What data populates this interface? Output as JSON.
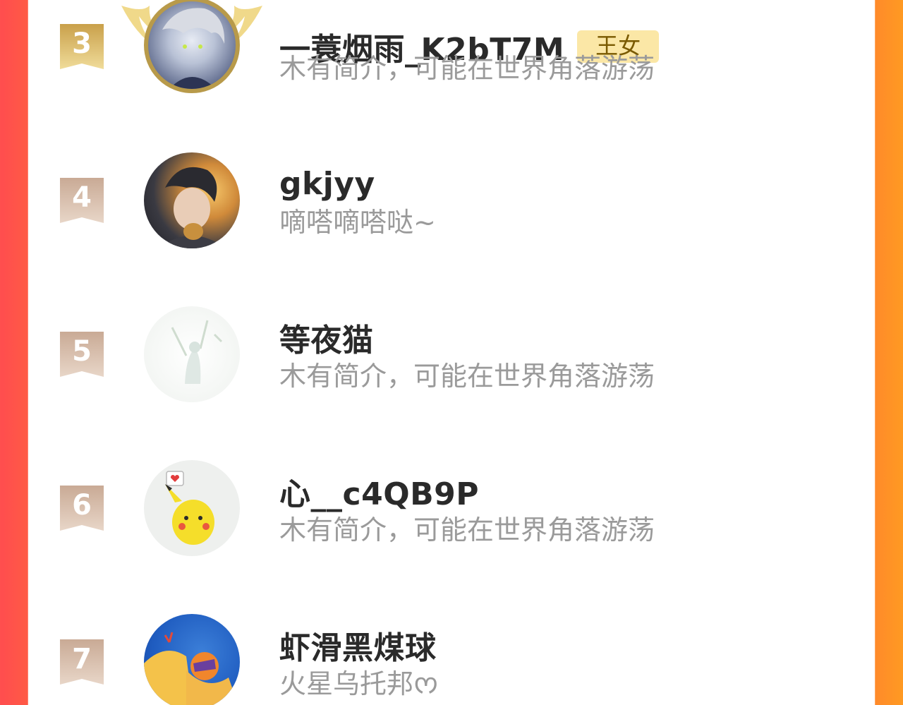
{
  "ranking": {
    "items": [
      {
        "rank": "3",
        "name": "一蓑烟雨_K2bT7M",
        "badge": "王女",
        "bio": "木有简介，可能在世界角落游荡",
        "rank_color": "#d9b45c"
      },
      {
        "rank": "4",
        "name": "gkjyy",
        "bio": "嘀嗒嘀嗒哒~",
        "rank_color": "#d2b8a6"
      },
      {
        "rank": "5",
        "name": "等夜猫",
        "bio": "木有简介，可能在世界角落游荡",
        "rank_color": "#d2b8a6"
      },
      {
        "rank": "6",
        "name": "心__c4QB9P",
        "bio": "木有简介，可能在世界角落游荡",
        "rank_color": "#d2b8a6"
      },
      {
        "rank": "7",
        "name": "虾滑黑煤球",
        "bio": "火星乌托邦ᰔ",
        "rank_color": "#d2b8a6"
      }
    ]
  },
  "colors": {
    "left_edge": "#ff4d4f",
    "right_edge": "#ff9a22",
    "gold_badge_bg": "#fbe7a6"
  }
}
